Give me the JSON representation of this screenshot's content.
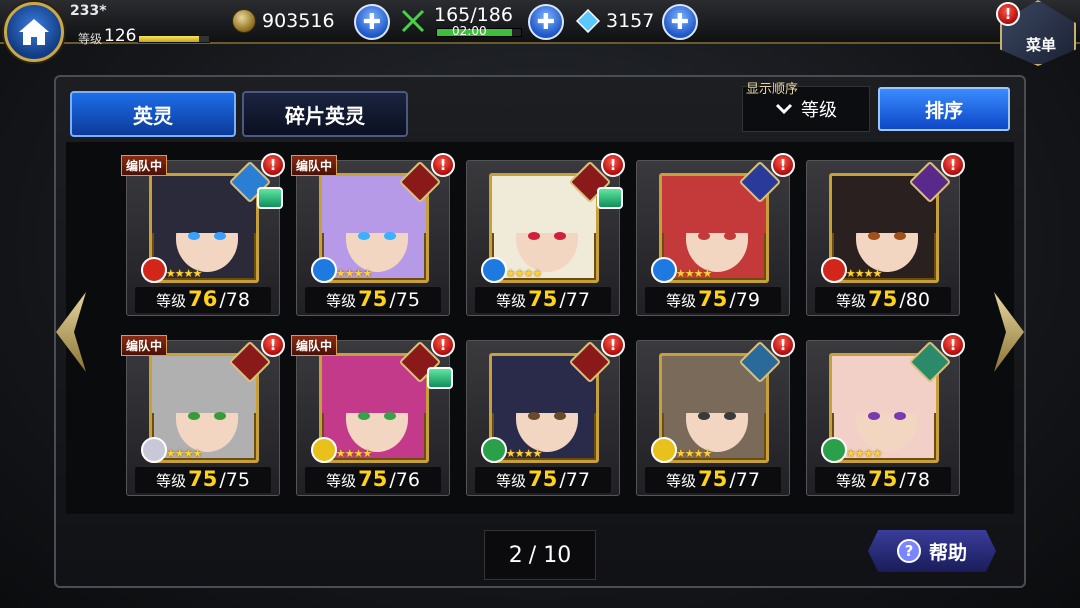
{
  "header": {
    "player_number": "233*",
    "level_label": "等级",
    "level_value": "126",
    "xp_fraction": 0.85,
    "gold": "903516",
    "stamina": "165/186",
    "stamina_timer": "02:00",
    "stamina_fraction": 0.89,
    "crystals": "3157",
    "menu_label": "菜单",
    "plus_glyph": "✚",
    "alert_glyph": "!"
  },
  "tabs": [
    {
      "label": "英灵",
      "active": true
    },
    {
      "label": "碎片英灵",
      "active": false
    }
  ],
  "sort": {
    "caption": "显示顺序",
    "selected": "等级",
    "button_label": "排序"
  },
  "party_tag": "编队中",
  "level_label": "等级",
  "stars_text": "★★★★★",
  "cards": [
    {
      "name": "hero-1",
      "cur": "76",
      "max": "/78",
      "in_party": true,
      "hair": "#2a2a3a",
      "eye": "#3aa0ff",
      "element": "fire",
      "element_color": "#d3261a",
      "class_color": "#2a7fd4",
      "book": true
    },
    {
      "name": "hero-2",
      "cur": "75",
      "max": "/75",
      "in_party": true,
      "hair": "#b69ae8",
      "eye": "#3ab0ff",
      "element": "water",
      "element_color": "#1e7ae0",
      "class_color": "#8a1a1a",
      "book": false
    },
    {
      "name": "hero-3",
      "cur": "75",
      "max": "/77",
      "in_party": false,
      "hair": "#f0ead8",
      "eye": "#d0203a",
      "element": "water",
      "element_color": "#1e7ae0",
      "class_color": "#8a1a1a",
      "book": true
    },
    {
      "name": "hero-4",
      "cur": "75",
      "max": "/79",
      "in_party": false,
      "hair": "#c43a3a",
      "eye": "#c43a3a",
      "element": "water",
      "element_color": "#1e7ae0",
      "class_color": "#2a3a9a",
      "book": false
    },
    {
      "name": "hero-5",
      "cur": "75",
      "max": "/80",
      "in_party": false,
      "hair": "#2a2020",
      "eye": "#a0501a",
      "element": "fire",
      "element_color": "#d3261a",
      "class_color": "#5a2a8a",
      "book": false
    },
    {
      "name": "hero-6",
      "cur": "75",
      "max": "/75",
      "in_party": true,
      "hair": "#b0b0b0",
      "eye": "#3a9a3a",
      "element": "light",
      "element_color": "#c8c8d8",
      "class_color": "#8a1a1a",
      "book": false
    },
    {
      "name": "hero-7",
      "cur": "75",
      "max": "/76",
      "in_party": true,
      "hair": "#c43a8a",
      "eye": "#3aa04a",
      "element": "thunder",
      "element_color": "#e8c21a",
      "class_color": "#8a1a1a",
      "book": true
    },
    {
      "name": "hero-8",
      "cur": "75",
      "max": "/77",
      "in_party": false,
      "hair": "#2a2a4a",
      "eye": "#6a4a2a",
      "element": "wind",
      "element_color": "#2aa04a",
      "class_color": "#8a1a1a",
      "book": false
    },
    {
      "name": "hero-9",
      "cur": "75",
      "max": "/77",
      "in_party": false,
      "hair": "#7a6a5a",
      "eye": "#3a3a3a",
      "element": "thunder",
      "element_color": "#e8c21a",
      "class_color": "#2a6a9a",
      "book": false
    },
    {
      "name": "hero-10",
      "cur": "75",
      "max": "/78",
      "in_party": false,
      "hair": "#f2d0c8",
      "eye": "#7a3ab0",
      "element": "wind",
      "element_color": "#2aa04a",
      "class_color": "#2a8a6a",
      "book": false
    }
  ],
  "pager": {
    "current": "2",
    "total": "/ 10"
  },
  "help": {
    "label": "帮助",
    "icon": "?"
  }
}
